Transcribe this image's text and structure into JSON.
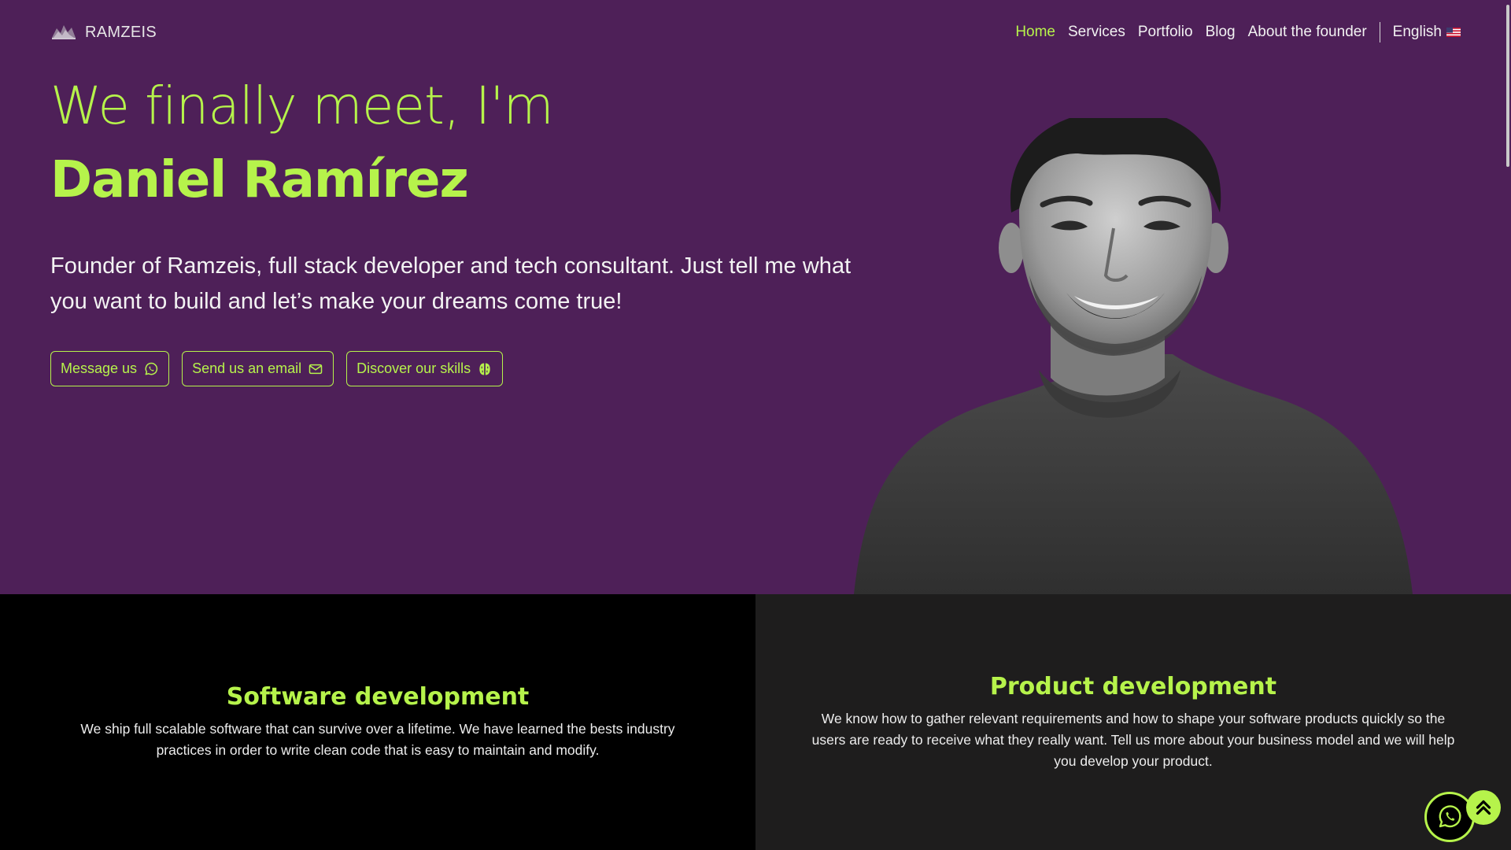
{
  "colors": {
    "accent": "#b6f34b",
    "hero_background": "#4e2058",
    "section_dark": "#1e1d1d",
    "section_black": "#000000"
  },
  "nav": {
    "brand": "RAMZEIS",
    "links": [
      {
        "label": "Home",
        "active": true
      },
      {
        "label": "Services"
      },
      {
        "label": "Portfolio"
      },
      {
        "label": "Blog"
      },
      {
        "label": "About the founder"
      }
    ],
    "language": "English",
    "language_icon": "us-flag-icon"
  },
  "hero": {
    "greeting": "We finally meet, I'm",
    "name": "Daniel Ramírez",
    "subtitle": "Founder of Ramzeis, full stack developer and tech consultant. Just tell me what you want to build and let’s make your dreams come true!",
    "buttons": [
      {
        "label": "Message us",
        "icon": "whatsapp-icon"
      },
      {
        "label": "Send us an email",
        "icon": "envelope-icon"
      },
      {
        "label": "Discover our skills",
        "icon": "brain-icon"
      }
    ]
  },
  "services": [
    {
      "title": "Software development",
      "description": "We ship full scalable software that can survive over a lifetime. We have learned the bests industry practices in order to write clean code that is easy to maintain and modify."
    },
    {
      "title": "Product development",
      "description": "We know how to gather relevant requirements and how to shape your software products quickly so the users are ready to receive what they really want. Tell us more about your business model and we will help you develop your product."
    }
  ],
  "floating": {
    "chat_icon": "whatsapp-icon",
    "scroll_top_icon": "double-chevron-up-icon"
  }
}
